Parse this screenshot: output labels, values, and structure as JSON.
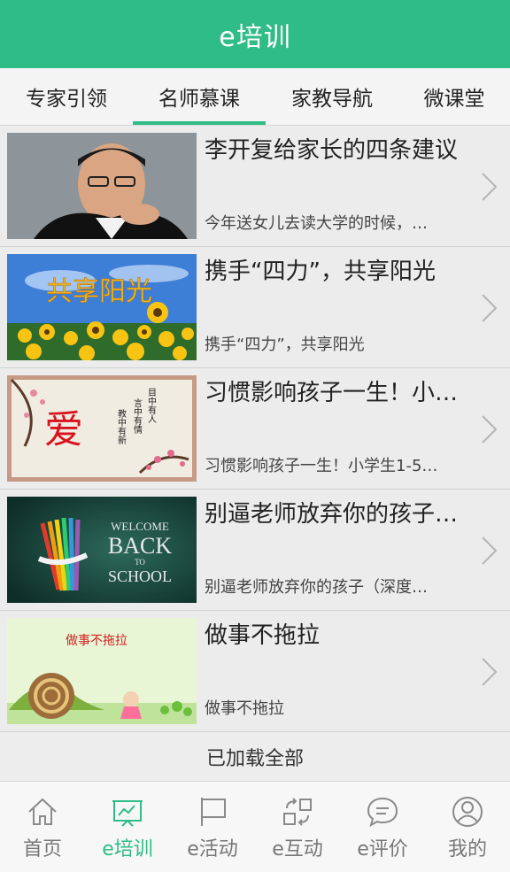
{
  "header": {
    "title": "e培训"
  },
  "tabs": [
    {
      "label": "专家引领"
    },
    {
      "label": "名师慕课",
      "active": true
    },
    {
      "label": "家教导航"
    },
    {
      "label": "微课堂"
    }
  ],
  "items": [
    {
      "title": "李开复给家长的四条建议",
      "desc": "今年送女儿去读大学的时候，…",
      "thumb": "portrait-photo"
    },
    {
      "title": "携手“四力”，共享阳光",
      "desc": "携手“四力”，共享阳光",
      "thumb": "sunflower-field",
      "thumb_text": "共享阳光"
    },
    {
      "title": "习惯影响孩子一生！小…",
      "desc": "习惯影响孩子一生！小学生1-5…",
      "thumb": "love-calligraphy",
      "thumb_text": "爱",
      "thumb_lines": [
        "目中有人",
        "言中有情",
        "教中有新"
      ]
    },
    {
      "title": "别逼老师放弃你的孩子…",
      "desc": "别逼老师放弃你的孩子（深度…",
      "thumb": "back-to-school-chalkboard",
      "thumb_lines": [
        "WELCOME",
        "BACK",
        "TO",
        "SCHOOL"
      ]
    },
    {
      "title": "做事不拖拉",
      "desc": "做事不拖拉",
      "thumb": "snail-cartoon",
      "thumb_text": "做事不拖拉"
    }
  ],
  "footer_status": "已加载全部",
  "bottom_nav": [
    {
      "label": "首页",
      "icon": "home-icon"
    },
    {
      "label": "e培训",
      "icon": "training-screen-icon",
      "active": true
    },
    {
      "label": "e活动",
      "icon": "flag-icon"
    },
    {
      "label": "e互动",
      "icon": "exchange-icon"
    },
    {
      "label": "e评价",
      "icon": "chat-bubble-icon"
    },
    {
      "label": "我的",
      "icon": "user-icon"
    }
  ],
  "colors": {
    "accent": "#2fbc86",
    "inactive": "#777777"
  }
}
